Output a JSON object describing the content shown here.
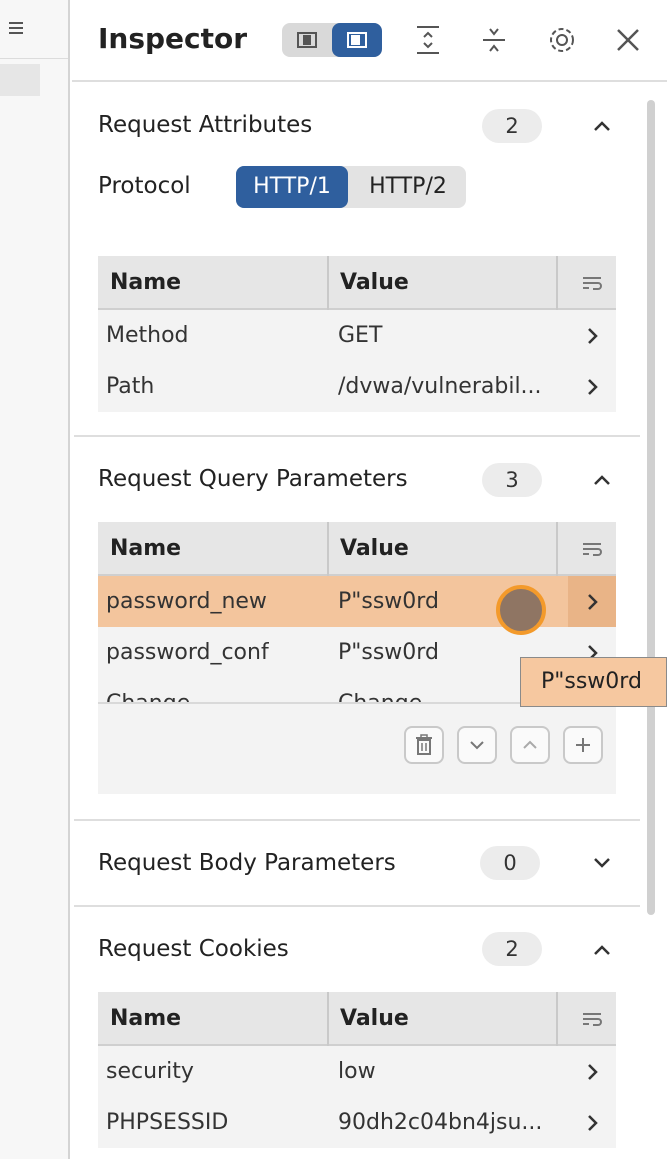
{
  "inspector": {
    "title": "Inspector"
  },
  "request_attributes": {
    "title": "Request Attributes",
    "count": "2",
    "protocol_label": "Protocol",
    "protocol_options": [
      "HTTP/1",
      "HTTP/2"
    ],
    "selected_protocol": "HTTP/1",
    "table": {
      "headers": [
        "Name",
        "Value"
      ],
      "rows": [
        {
          "name": "Method",
          "value": "GET"
        },
        {
          "name": "Path",
          "value": "/dvwa/vulnerabil..."
        }
      ]
    }
  },
  "query_parameters": {
    "title": "Request Query Parameters",
    "count": "3",
    "table": {
      "headers": [
        "Name",
        "Value"
      ],
      "rows": [
        {
          "name": "password_new",
          "value": "P\"ssw0rd"
        },
        {
          "name": "password_conf",
          "value": "P\"ssw0rd"
        },
        {
          "name": "Change",
          "value": "Change"
        }
      ]
    },
    "tooltip": "P\"ssw0rd"
  },
  "body_parameters": {
    "title": "Request Body Parameters",
    "count": "0"
  },
  "cookies": {
    "title": "Request Cookies",
    "count": "2",
    "table": {
      "headers": [
        "Name",
        "Value"
      ],
      "rows": [
        {
          "name": "security",
          "value": "low"
        },
        {
          "name": "PHPSESSID",
          "value": "90dh2c04bn4jsu..."
        }
      ]
    }
  },
  "colors": {
    "accent": "#2f5f9e",
    "selected_row": "#f3c59d",
    "cursor_ring": "#f39a2b"
  }
}
